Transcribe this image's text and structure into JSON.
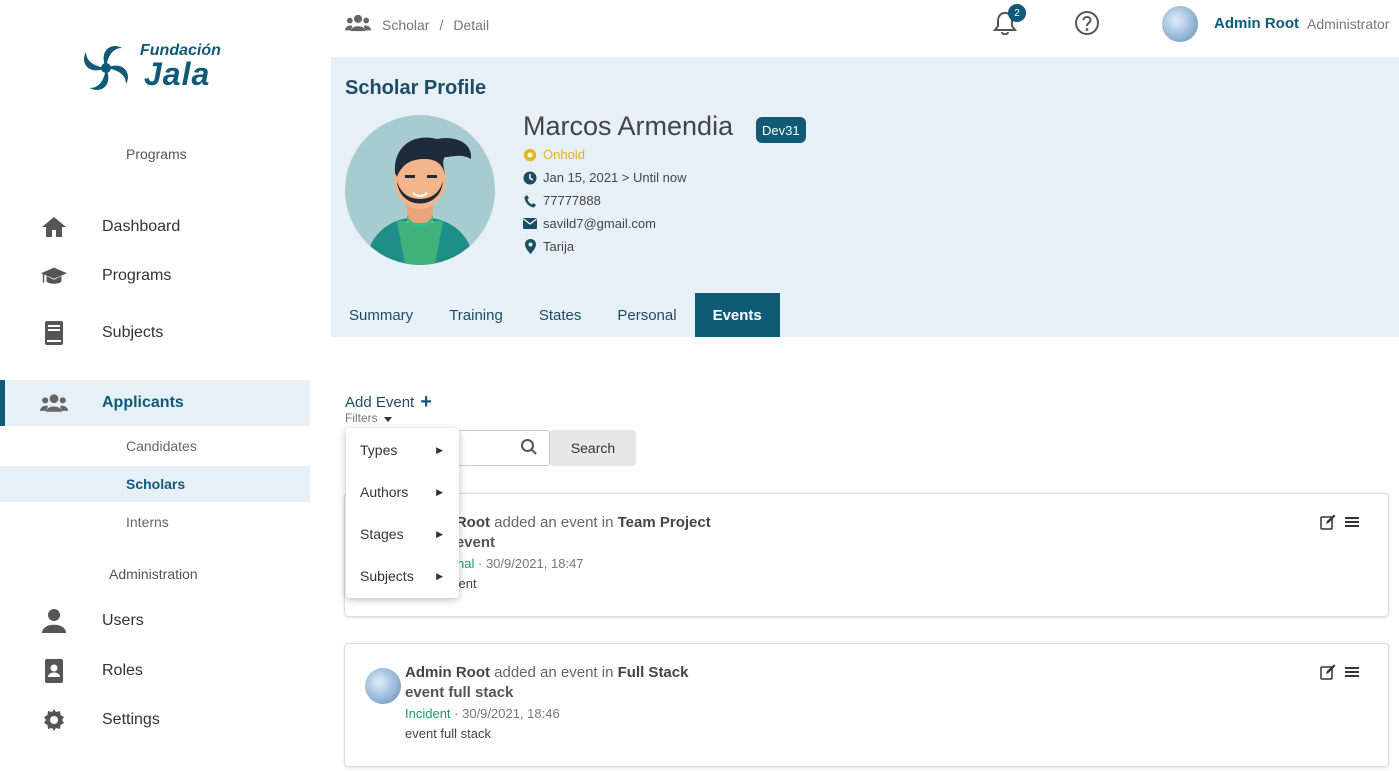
{
  "sidebar": {
    "logo": {
      "line1": "Fundación",
      "line2": "Jala"
    },
    "sections": {
      "programs": "Programs",
      "administration": "Administration"
    },
    "items": [
      {
        "label": "Dashboard",
        "icon": "home-icon"
      },
      {
        "label": "Programs",
        "icon": "graduation-cap-icon"
      },
      {
        "label": "Subjects",
        "icon": "book-icon"
      },
      {
        "label": "Applicants",
        "icon": "users-icon"
      },
      {
        "label": "Users",
        "icon": "user-icon"
      },
      {
        "label": "Roles",
        "icon": "id-badge-icon"
      },
      {
        "label": "Settings",
        "icon": "gear-icon"
      }
    ],
    "subitems": [
      {
        "label": "Candidates"
      },
      {
        "label": "Scholars"
      },
      {
        "label": "Interns"
      }
    ]
  },
  "topbar": {
    "breadcrumb": [
      "Scholar",
      "/",
      "Detail"
    ],
    "notifications": "2",
    "user_name": "Admin Root",
    "user_role": "Administrator"
  },
  "profile": {
    "title": "Scholar Profile",
    "name": "Marcos Armendia",
    "tag": "Dev31",
    "status": "Onhold",
    "dates": "Jan 15, 2021 > Until now",
    "phone": "77777888",
    "email": "savild7@gmail.com",
    "city": "Tarija",
    "tabs": [
      "Summary",
      "Training",
      "States",
      "Personal",
      "Events"
    ],
    "active_tab": "Events"
  },
  "events": {
    "add_label": "Add Event",
    "filters_label": "Filters",
    "search_placeholder": "",
    "search_button": "Search",
    "filter_menu": [
      "Types",
      "Authors",
      "Stages",
      "Subjects"
    ],
    "list": [
      {
        "author": "Admin Root",
        "action": "added an event in",
        "program": "Team Project",
        "title": "boring event",
        "type": "Motivational",
        "date": "30/9/2021, 18:47",
        "description": "boring event"
      },
      {
        "author": "Admin Root",
        "action": "added an event in",
        "program": "Full Stack",
        "title": "event full stack",
        "type": "Incident",
        "date": "30/9/2021, 18:46",
        "description": "event full stack"
      }
    ]
  },
  "colors": {
    "primary": "#0e5a77",
    "panel": "#e8f0f7",
    "status": "#e6b020",
    "type": "#1b9a6a"
  }
}
